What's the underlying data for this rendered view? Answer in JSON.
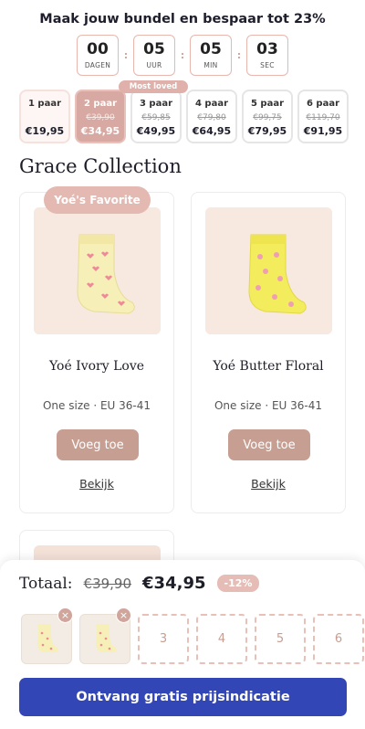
{
  "promo": {
    "title": "Maak jouw bundel en bespaar tot 23%"
  },
  "countdown": [
    {
      "value": "00",
      "label": "DAGEN"
    },
    {
      "value": "05",
      "label": "UUR"
    },
    {
      "value": "05",
      "label": "MIN"
    },
    {
      "value": "03",
      "label": "SEC"
    }
  ],
  "tiers": [
    {
      "name": "1 paar",
      "old": "",
      "price": "€19,95"
    },
    {
      "name": "2 paar",
      "old": "€39,90",
      "price": "€34,95",
      "badge": "Most loved"
    },
    {
      "name": "3 paar",
      "old": "€59,85",
      "price": "€49,95"
    },
    {
      "name": "4 paar",
      "old": "€79,80",
      "price": "€64,95"
    },
    {
      "name": "5 paar",
      "old": "€99,75",
      "price": "€79,95"
    },
    {
      "name": "6 paar",
      "old": "€119,70",
      "price": "€91,95"
    }
  ],
  "collection": {
    "title": "Grace Collection"
  },
  "products": [
    {
      "badge": "Yoé's Favorite",
      "name": "Yoé Ivory Love",
      "size": "One size · EU 36-41",
      "add_label": "Voeg toe",
      "view_label": "Bekijk"
    },
    {
      "name": "Yoé Butter Floral",
      "size": "One size · EU 36-41",
      "add_label": "Voeg toe",
      "view_label": "Bekijk"
    }
  ],
  "bundle": {
    "total_label": "Totaal:",
    "old_price": "€39,90",
    "new_price": "€34,95",
    "discount": "-12%",
    "remove_icon": "×",
    "slots": [
      "3",
      "4",
      "5",
      "6"
    ],
    "cta": "Ontvang gratis prijsindicatie"
  },
  "colors": {
    "accent": "#c79e92",
    "cta": "#3246b5",
    "badge": "#e3b9b2"
  }
}
